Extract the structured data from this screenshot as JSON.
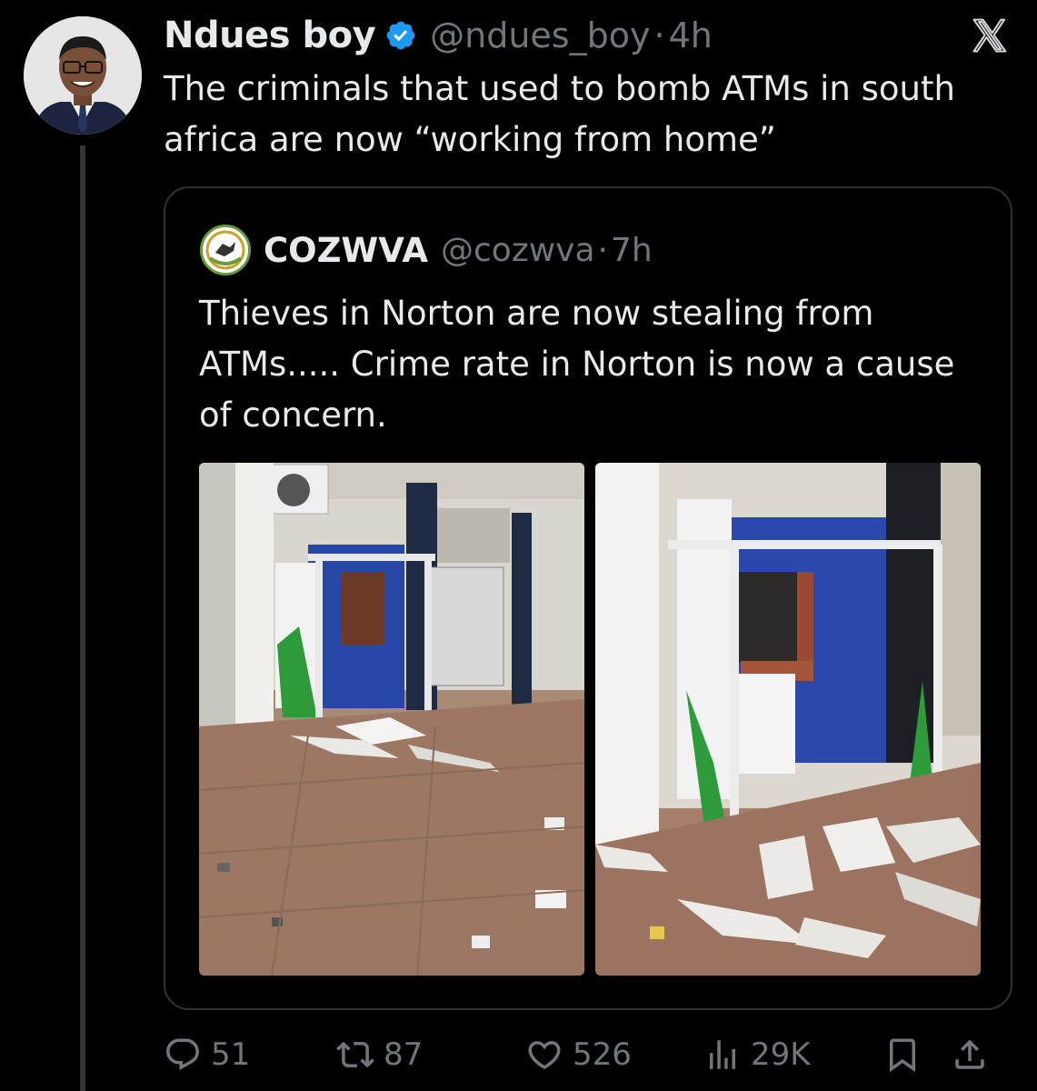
{
  "tweet": {
    "author_name": "Ndues boy",
    "handle": "@ndues_boy",
    "separator": "·",
    "time": "4h",
    "text": "The criminals that used to bomb ATMs in south africa are now  “working from home”"
  },
  "quoted_tweet": {
    "author_name": "COZWVA",
    "handle": "@cozwva",
    "separator": "·",
    "time": "7h",
    "text": "Thieves in Norton are now stealing from ATMs..... Crime rate in Norton is now a cause of concern."
  },
  "actions": {
    "replies": "51",
    "retweets": "87",
    "likes": "526",
    "views": "29K"
  },
  "icons": [
    "verified-badge-icon",
    "x-logo-icon",
    "reply-icon",
    "retweet-icon",
    "like-icon",
    "views-icon",
    "bookmark-icon",
    "share-icon"
  ],
  "colors": {
    "background": "#000000",
    "text_primary": "#e7e9ea",
    "text_secondary": "#71767b",
    "verified": "#1d9bf0",
    "border": "#2f3336"
  }
}
